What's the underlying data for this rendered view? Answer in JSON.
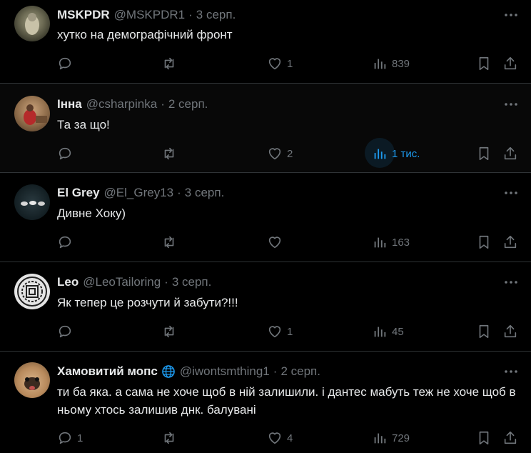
{
  "tweets": [
    {
      "name": "MSKPDR",
      "handle": "@MSKPDR1",
      "date": "3 серп.",
      "text": "хутко на демографічний фронт",
      "replies": "",
      "retweets": "",
      "likes": "1",
      "views": "839"
    },
    {
      "name": "Інна",
      "handle": "@csharpinka",
      "date": "2 серп.",
      "text": "Та за що!",
      "replies": "",
      "retweets": "",
      "likes": "2",
      "views": "1 тис."
    },
    {
      "name": "El Grey",
      "handle": "@El_Grey13",
      "date": "3 серп.",
      "text": "Дивне Хоку)",
      "replies": "",
      "retweets": "",
      "likes": "",
      "views": "163"
    },
    {
      "name": "Leo",
      "handle": "@LeoTailoring",
      "date": "3 серп.",
      "text": "Як тепер це розчути й забути?!!!",
      "replies": "",
      "retweets": "",
      "likes": "1",
      "views": "45"
    },
    {
      "name": "Хамовитий мопс",
      "handle": "@iwontsmthing1",
      "date": "2 серп.",
      "text": "ти ба яка. а сама не хоче щоб в ній залишили. і дантес мабуть теж не хоче щоб в ньому хтось залишив днк. балувані",
      "replies": "1",
      "retweets": "",
      "likes": "4",
      "views": "729"
    }
  ],
  "separator": "·",
  "colors": {
    "background": "#000000",
    "text": "#e7e9ea",
    "muted": "#71767b",
    "accent": "#1d9bf0",
    "divider": "#2f3336"
  },
  "icons": [
    "more-icon",
    "reply-icon",
    "retweet-icon",
    "like-icon",
    "views-icon",
    "bookmark-icon",
    "share-icon",
    "globe-verified-icon"
  ]
}
